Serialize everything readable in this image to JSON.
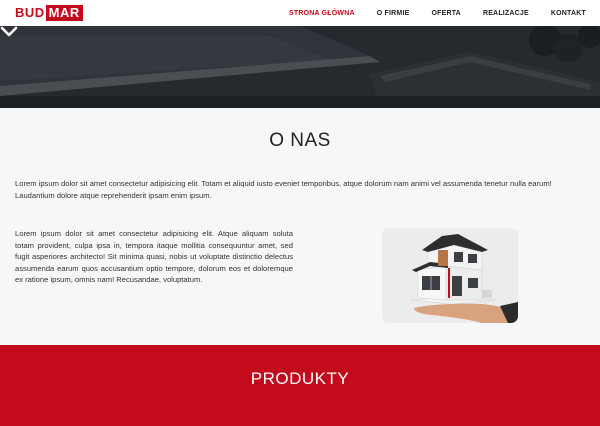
{
  "logo": {
    "part1": "BUD",
    "part2": "MAR"
  },
  "nav": {
    "items": [
      {
        "label": "STRONA GŁÓWNA",
        "active": true
      },
      {
        "label": "O FIRMIE",
        "active": false
      },
      {
        "label": "OFERTA",
        "active": false
      },
      {
        "label": "REALIZACJE",
        "active": false
      },
      {
        "label": "KONTAKT",
        "active": false
      }
    ]
  },
  "hero": {
    "scroll_icon": "chevron-down-icon"
  },
  "about": {
    "title": "O NAS",
    "paragraph1": "Lorem ipsum dolor sit amet consectetur adipisicing elit. Totam et aliquid iusto eveniet temporibus, atque dolorum nam animi vel assumenda tenetur nulla earum! Laudantium dolore atque reprehenderit ipsam enim ipsum.",
    "paragraph2": "Lorem ipsum dolor sit amet consectetur adipisicing elit. Atque aliquam soluta totam provident, culpa ipsa in, tempora itaque mollitia consequuntur amet, sed fugit asperiores architecto! Sit minima quasi, nobis ut voluptate distinctio delectus assumenda earum quos accusantium optio tempore, dolorum eos et doloremque ex ratione ipsum, omnis nam! Recusandae, voluptatum."
  },
  "products": {
    "title": "PRODUKTY"
  },
  "colors": {
    "accent": "#c40b1c",
    "nav_bg": "#ffffff",
    "section_bg": "#f6f7f9"
  }
}
